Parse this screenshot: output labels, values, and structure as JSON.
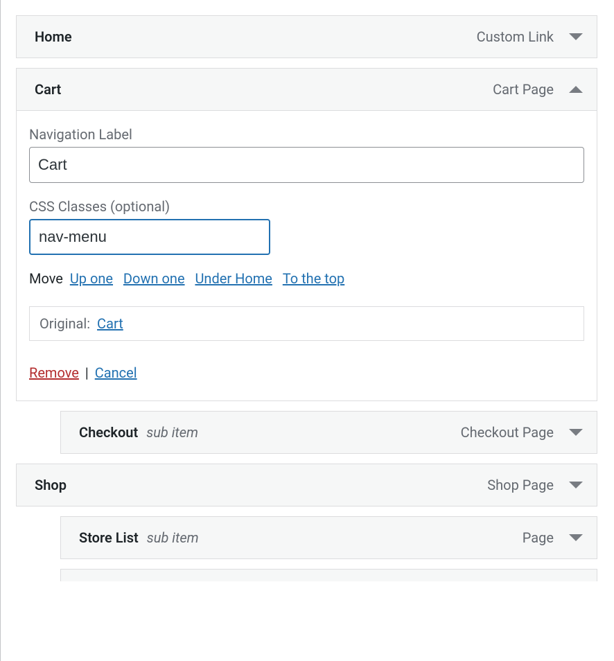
{
  "items": {
    "home": {
      "title": "Home",
      "type": "Custom Link"
    },
    "cart": {
      "title": "Cart",
      "type": "Cart Page",
      "nav_label_field": "Navigation Label",
      "nav_label_value": "Cart",
      "css_field": "CSS Classes (optional)",
      "css_value": "nav-menu",
      "move_label": "Move",
      "move_up": "Up one",
      "move_down": "Down one",
      "move_under": "Under Home",
      "move_top": "To the top",
      "original_label": "Original:",
      "original_link": "Cart",
      "remove": "Remove",
      "cancel": "Cancel"
    },
    "checkout": {
      "title": "Checkout",
      "sub": "sub item",
      "type": "Checkout Page"
    },
    "shop": {
      "title": "Shop",
      "type": "Shop Page"
    },
    "storelist": {
      "title": "Store List",
      "sub": "sub item",
      "type": "Page"
    }
  }
}
